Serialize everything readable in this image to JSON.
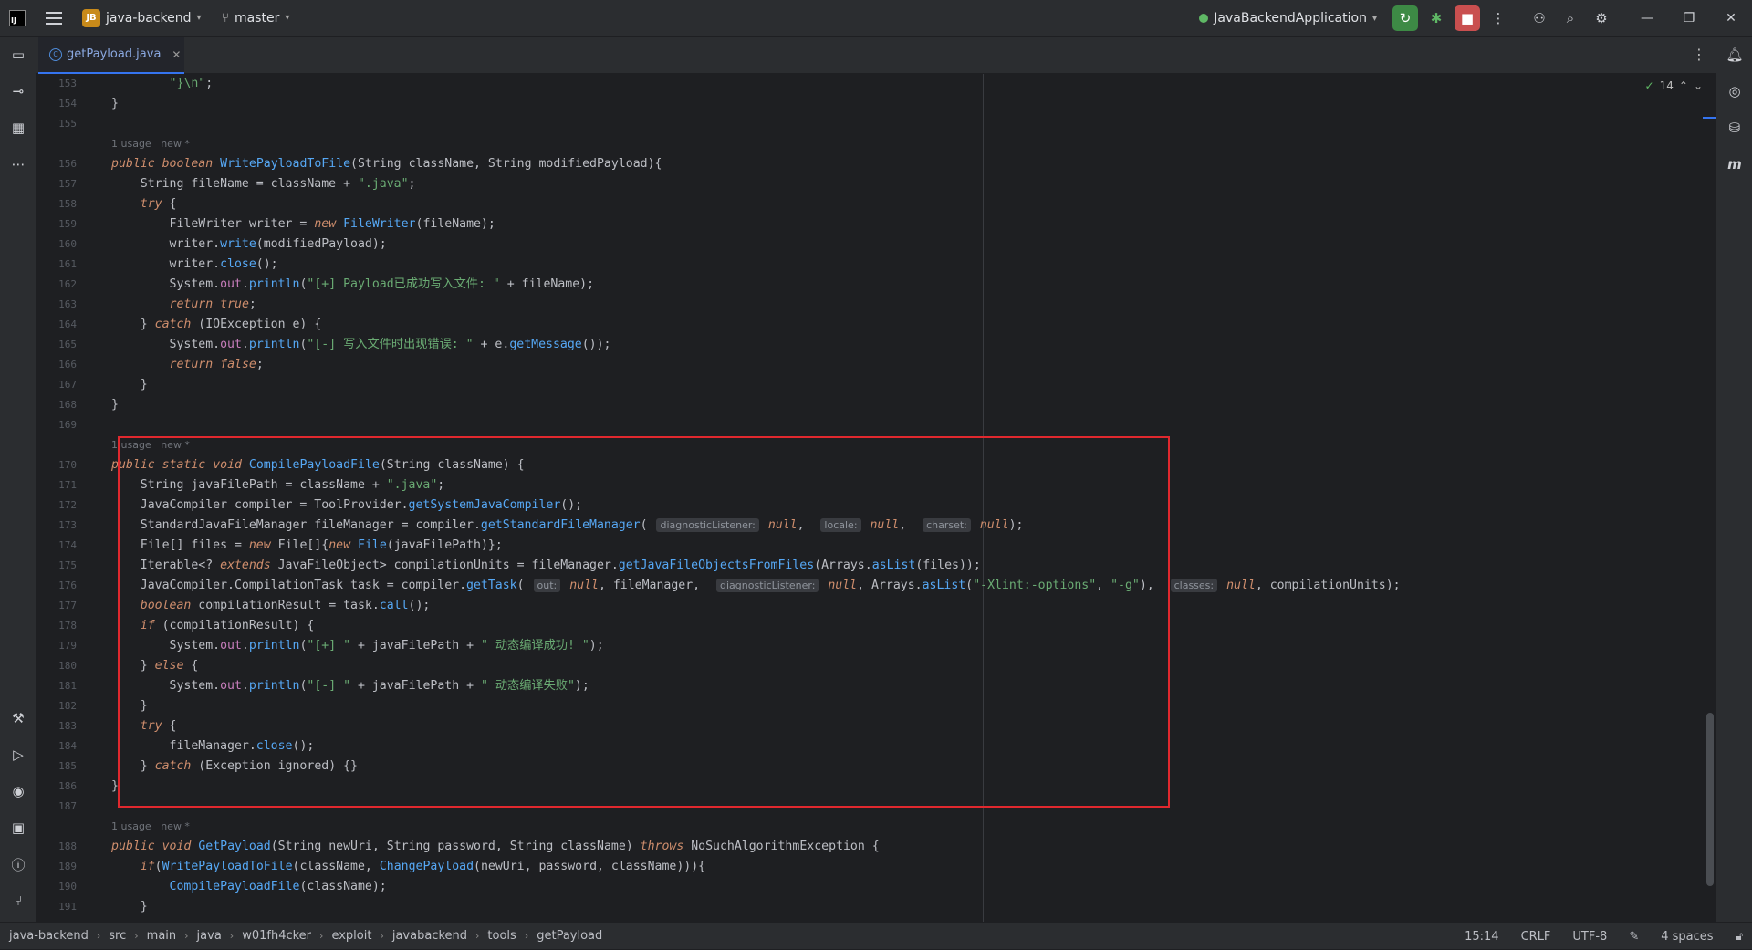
{
  "titlebar": {
    "app_logo": "IJ",
    "project_badge": "JB",
    "project_name": "java-backend",
    "branch": "master",
    "run_config": "JavaBackendApplication"
  },
  "tabs": [
    {
      "label": "getPayload.java"
    }
  ],
  "editor": {
    "inspection_count": "14",
    "hint_usage": "1 usage",
    "hint_new": "new *",
    "lines": [
      {
        "n": "153",
        "t": "        \"}\\n\";"
      },
      {
        "n": "154",
        "t": "}"
      },
      {
        "n": "155",
        "t": ""
      },
      {
        "n": "156",
        "t": "public boolean WritePayloadToFile(String className, String modifiedPayload){"
      },
      {
        "n": "157",
        "t": "    String fileName = className + \".java\";"
      },
      {
        "n": "158",
        "t": "    try {"
      },
      {
        "n": "159",
        "t": "        FileWriter writer = new FileWriter(fileName);"
      },
      {
        "n": "160",
        "t": "        writer.write(modifiedPayload);"
      },
      {
        "n": "161",
        "t": "        writer.close();"
      },
      {
        "n": "162",
        "t": "        System.out.println(\"[+] Payload已成功写入文件: \" + fileName);"
      },
      {
        "n": "163",
        "t": "        return true;"
      },
      {
        "n": "164",
        "t": "    } catch (IOException e) {"
      },
      {
        "n": "165",
        "t": "        System.out.println(\"[-] 写入文件时出现错误: \" + e.getMessage());"
      },
      {
        "n": "166",
        "t": "        return false;"
      },
      {
        "n": "167",
        "t": "    }"
      },
      {
        "n": "168",
        "t": "}"
      },
      {
        "n": "169",
        "t": ""
      },
      {
        "n": "170",
        "t": "public static void CompilePayloadFile(String className) {"
      },
      {
        "n": "171",
        "t": "    String javaFilePath = className + \".java\";"
      },
      {
        "n": "172",
        "t": "    JavaCompiler compiler = ToolProvider.getSystemJavaCompiler();"
      },
      {
        "n": "173",
        "t": "    StandardJavaFileManager fileManager = compiler.getStandardFileManager( diagnosticListener: null,  locale: null,  charset: null);"
      },
      {
        "n": "174",
        "t": "    File[] files = new File[]{new File(javaFilePath)};"
      },
      {
        "n": "175",
        "t": "    Iterable<? extends JavaFileObject> compilationUnits = fileManager.getJavaFileObjectsFromFiles(Arrays.asList(files));"
      },
      {
        "n": "176",
        "t": "    JavaCompiler.CompilationTask task = compiler.getTask( out: null, fileManager,  diagnosticListener: null, Arrays.asList(\"-Xlint:-options\", \"-g\"),  classes: null, compilationUnits);"
      },
      {
        "n": "177",
        "t": "    boolean compilationResult = task.call();"
      },
      {
        "n": "178",
        "t": "    if (compilationResult) {"
      },
      {
        "n": "179",
        "t": "        System.out.println(\"[+] \" + javaFilePath + \" 动态编译成功! \");"
      },
      {
        "n": "180",
        "t": "    } else {"
      },
      {
        "n": "181",
        "t": "        System.out.println(\"[-] \" + javaFilePath + \" 动态编译失败\");"
      },
      {
        "n": "182",
        "t": "    }"
      },
      {
        "n": "183",
        "t": "    try {"
      },
      {
        "n": "184",
        "t": "        fileManager.close();"
      },
      {
        "n": "185",
        "t": "    } catch (Exception ignored) {}"
      },
      {
        "n": "186",
        "t": "}"
      },
      {
        "n": "187",
        "t": ""
      },
      {
        "n": "188",
        "t": "public void GetPayload(String newUri, String password, String className) throws NoSuchAlgorithmException {"
      },
      {
        "n": "189",
        "t": "    if(WritePayloadToFile(className, ChangePayload(newUri, password, className))){"
      },
      {
        "n": "190",
        "t": "        CompilePayloadFile(className);"
      },
      {
        "n": "191",
        "t": "    }"
      }
    ]
  },
  "statusbar": {
    "breadcrumbs": [
      "java-backend",
      "src",
      "main",
      "java",
      "w01fh4cker",
      "exploit",
      "javabackend",
      "tools",
      "getPayload"
    ],
    "position": "15:14",
    "line_sep": "CRLF",
    "encoding": "UTF-8",
    "indent": "4 spaces"
  },
  "colors": {
    "accent": "#3574f0",
    "highlight_box": "#e0282e",
    "run_green": "#3d8a45",
    "stop_red": "#c94f4f"
  }
}
